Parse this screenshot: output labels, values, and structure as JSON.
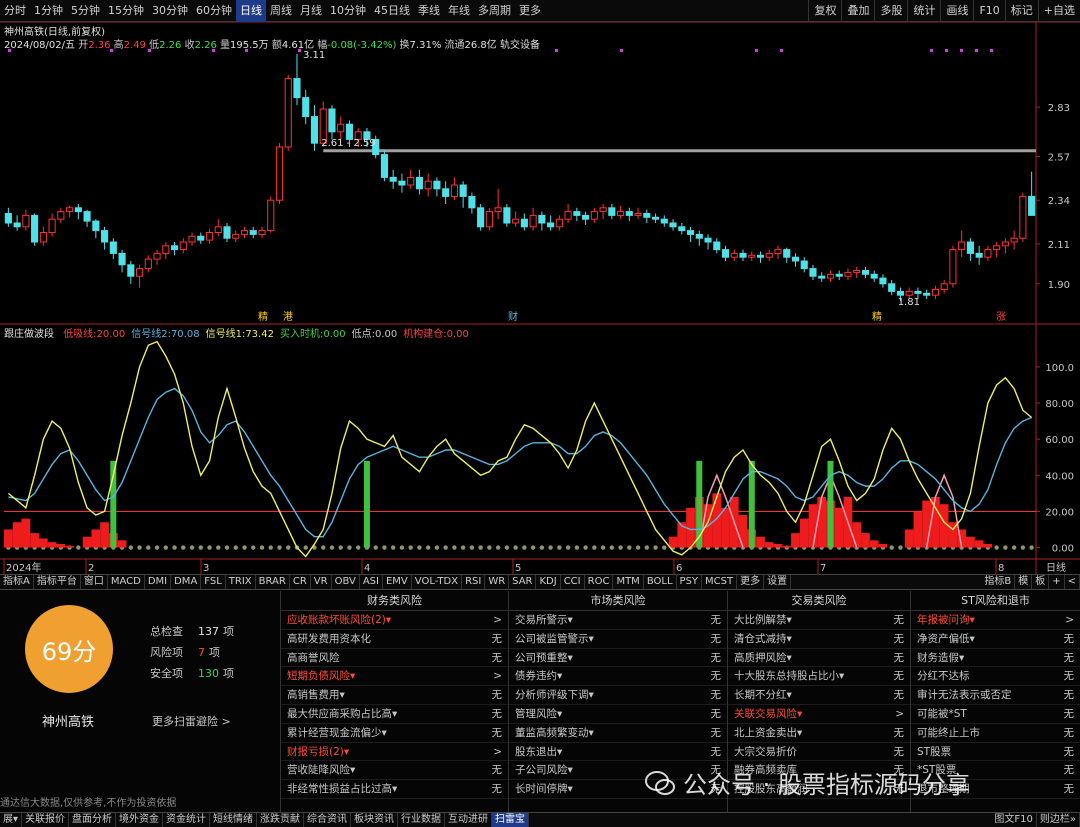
{
  "topbar": {
    "timeframes": [
      "分时",
      "1分钟",
      "5分钟",
      "15分钟",
      "30分钟",
      "60分钟",
      "日线",
      "周线",
      "月线",
      "10分钟",
      "45日线",
      "季线",
      "年线",
      "多周期",
      "更多"
    ],
    "active_timeframe": "日线",
    "tools": [
      "复权",
      "叠加",
      "多股",
      "统计",
      "画线",
      "F10",
      "标记",
      "+自选"
    ]
  },
  "header": {
    "title": "神州高铁(日线,前复权)",
    "date": "2024/08/02/五",
    "open_label": "开",
    "open": "2.36",
    "high_label": "高",
    "high": "2.49",
    "low_label": "低",
    "low": "2.26",
    "close_label": "收",
    "close": "2.26",
    "volume_label": "量",
    "volume": "195.5万",
    "amount_label": "额",
    "amount": "4.61亿",
    "change_label": "幅",
    "change": "-0.08(-3.42%)",
    "turnover_label": "换",
    "turnover": "7.31%",
    "float_label": "流通",
    "float_val": "26.8亿",
    "concept": "轨交设备"
  },
  "indicator_header": {
    "name": "跟庄做波段",
    "items": [
      {
        "label": "低吸线:",
        "value": "20.00",
        "color": "#ff4040"
      },
      {
        "label": "信号线2:",
        "value": "70.08",
        "color": "#5ab4e0"
      },
      {
        "label": "信号线1:",
        "value": "73.42",
        "color": "#f0f060"
      },
      {
        "label": "买入时机:",
        "value": "0.00",
        "color": "#40d040"
      },
      {
        "label": "低点:",
        "value": "0.00",
        "color": "#c8c8c8"
      },
      {
        "label": "机构建仓:",
        "value": "0.00",
        "color": "#ff4040"
      }
    ]
  },
  "annotations": {
    "peak_price": "3.11",
    "range_label": "2.61 - 2.59",
    "low_price": "1.81",
    "markers": [
      {
        "text": "精",
        "color": "#ffd000"
      },
      {
        "text": "港",
        "color": "#ffd000"
      },
      {
        "text": "财",
        "color": "#5ab4e0"
      },
      {
        "text": "精",
        "color": "#ffd000"
      },
      {
        "text": "涨",
        "color": "#ff4040"
      }
    ]
  },
  "price_axis": [
    "2.83",
    "2.57",
    "2.34",
    "2.11",
    "1.90"
  ],
  "indicator_axis": [
    "100.0",
    "80.00",
    "60.00",
    "40.00",
    "20.00",
    "0.00"
  ],
  "date_axis": {
    "labels": [
      "2024年",
      "2",
      "3",
      "4",
      "5",
      "6",
      "7",
      "8"
    ],
    "period": "日线"
  },
  "tabs": {
    "items": [
      "指标A",
      "指标平台",
      "窗口",
      "MACD",
      "DMI",
      "DMA",
      "FSL",
      "TRIX",
      "BRAR",
      "CR",
      "VR",
      "OBV",
      "ASI",
      "EMV",
      "VOL-TDX",
      "RSI",
      "WR",
      "SAR",
      "KDJ",
      "CCI",
      "ROC",
      "MTM",
      "BOLL",
      "PSY",
      "MCST",
      "更多",
      "设置"
    ],
    "right": [
      "指标B",
      "模",
      "板",
      "+",
      "<"
    ]
  },
  "risk": {
    "score": "69分",
    "company": "神州高铁",
    "stats": [
      {
        "label": "总检查",
        "value": "137",
        "unit": "项",
        "color": "#e0e0e0"
      },
      {
        "label": "风险项",
        "value": "7",
        "unit": "项",
        "color": "#ff4a3a"
      },
      {
        "label": "安全项",
        "value": "130",
        "unit": "项",
        "color": "#40d060"
      }
    ],
    "more": "更多扫雷避险 >",
    "disclaimer": "通达信大数据,仅供参考,不作为投资依据",
    "columns": [
      {
        "title": "财务类风险",
        "rows": [
          {
            "name": "应收账款坏账风险(2)▾",
            "val": ">",
            "alert": true
          },
          {
            "name": "高研发费用资本化",
            "val": "无"
          },
          {
            "name": "高商誉风险",
            "val": "无"
          },
          {
            "name": "短期负债风险▾",
            "val": ">",
            "alert": true
          },
          {
            "name": "高销售费用▾",
            "val": "无"
          },
          {
            "name": "最大供应商采购占比高▾",
            "val": "无"
          },
          {
            "name": "累计经营现金流偏少▾",
            "val": "无"
          },
          {
            "name": "财报亏损(2)▾",
            "val": ">",
            "alert": true
          },
          {
            "name": "营收陡降风险▾",
            "val": "无"
          },
          {
            "name": "非经常性损益占比过高▾",
            "val": "无"
          }
        ]
      },
      {
        "title": "市场类风险",
        "rows": [
          {
            "name": "交易所警示▾",
            "val": "无"
          },
          {
            "name": "公司被监管警示▾",
            "val": "无"
          },
          {
            "name": "公司预重整▾",
            "val": "无"
          },
          {
            "name": "债券违约▾",
            "val": "无"
          },
          {
            "name": "分析师评级下调▾",
            "val": "无"
          },
          {
            "name": "管理风险▾",
            "val": "无"
          },
          {
            "name": "董监高频繁变动▾",
            "val": "无"
          },
          {
            "name": "股东退出▾",
            "val": "无"
          },
          {
            "name": "子公司风险▾",
            "val": "无"
          },
          {
            "name": "长时间停牌▾",
            "val": "无"
          }
        ]
      },
      {
        "title": "交易类风险",
        "rows": [
          {
            "name": "大比例解禁▾",
            "val": "无"
          },
          {
            "name": "清仓式减持▾",
            "val": "无"
          },
          {
            "name": "高质押风险▾",
            "val": "无"
          },
          {
            "name": "十大股东总持股占比小▾",
            "val": "无"
          },
          {
            "name": "长期不分红▾",
            "val": "无"
          },
          {
            "name": "关联交易风险▾",
            "val": ">",
            "alert": true
          },
          {
            "name": "北上资金卖出▾",
            "val": "无"
          },
          {
            "name": "大宗交易折价",
            "val": "无"
          },
          {
            "name": "融券高频卖库",
            "val": "无"
          },
          {
            "name": "控股股东高额润",
            "val": "无"
          }
        ]
      },
      {
        "title": "ST风险和退市",
        "rows": [
          {
            "name": "年报被问询▾",
            "val": ">",
            "alert": true
          },
          {
            "name": "净资产偏低▾",
            "val": "无"
          },
          {
            "name": "财务造假▾",
            "val": "无"
          },
          {
            "name": "分红不达标",
            "val": "无"
          },
          {
            "name": "审计无法表示或否定",
            "val": "无"
          },
          {
            "name": "可能被*ST",
            "val": "无"
          },
          {
            "name": "可能终止上市",
            "val": "无"
          },
          {
            "name": "ST股票",
            "val": "无"
          },
          {
            "name": "*ST股票",
            "val": "无"
          },
          {
            "name": "退市整理期",
            "val": "无"
          }
        ]
      }
    ]
  },
  "statusbar": {
    "items": [
      "展▾",
      "关联报价",
      "盘面分析",
      "境外资金",
      "资金统计",
      "短线情绪",
      "涨跌贡献",
      "综合资讯",
      "板块资讯",
      "行业数据",
      "互动进研",
      "扫雷宝"
    ],
    "active": "扫雷宝",
    "right": [
      "图文F10",
      "则边栏»"
    ]
  },
  "watermark": "公众号 · 股票指标源码分享",
  "colors": {
    "up": "#ff3030",
    "down": "#50e0e8",
    "signal1": "#f0f060",
    "signal2": "#5ab4e0",
    "buy": "#40c040",
    "risk_line": "#ff4040",
    "orange": "#f0a030"
  },
  "chart_data": {
    "type": "candlestick",
    "price_range": [
      1.72,
      3.12
    ],
    "indicator_range": [
      -8,
      116
    ],
    "candles": [
      [
        2.27,
        2.22,
        2.3,
        2.2
      ],
      [
        2.22,
        2.2,
        2.26,
        2.18
      ],
      [
        2.2,
        2.26,
        2.29,
        2.18
      ],
      [
        2.26,
        2.12,
        2.27,
        2.1
      ],
      [
        2.12,
        2.17,
        2.2,
        2.1
      ],
      [
        2.17,
        2.24,
        2.27,
        2.15
      ],
      [
        2.24,
        2.28,
        2.3,
        2.22
      ],
      [
        2.28,
        2.3,
        2.31,
        2.25
      ],
      [
        2.3,
        2.28,
        2.32,
        2.24
      ],
      [
        2.28,
        2.23,
        2.29,
        2.2
      ],
      [
        2.23,
        2.18,
        2.24,
        2.14
      ],
      [
        2.18,
        2.12,
        2.2,
        2.08
      ],
      [
        2.12,
        2.06,
        2.14,
        2.03
      ],
      [
        2.06,
        2.0,
        2.08,
        1.96
      ],
      [
        2.0,
        1.94,
        2.02,
        1.9
      ],
      [
        1.94,
        1.98,
        2.0,
        1.88
      ],
      [
        1.98,
        2.03,
        2.05,
        1.96
      ],
      [
        2.03,
        2.06,
        2.08,
        2.0
      ],
      [
        2.06,
        2.1,
        2.12,
        2.03
      ],
      [
        2.1,
        2.08,
        2.12,
        2.05
      ],
      [
        2.08,
        2.12,
        2.14,
        2.06
      ],
      [
        2.12,
        2.15,
        2.17,
        2.1
      ],
      [
        2.15,
        2.13,
        2.17,
        2.11
      ],
      [
        2.13,
        2.17,
        2.19,
        2.11
      ],
      [
        2.17,
        2.2,
        2.24,
        2.15
      ],
      [
        2.2,
        2.14,
        2.22,
        2.12
      ],
      [
        2.14,
        2.16,
        2.18,
        2.12
      ],
      [
        2.16,
        2.18,
        2.2,
        2.14
      ],
      [
        2.18,
        2.16,
        2.2,
        2.14
      ],
      [
        2.16,
        2.18,
        2.2,
        2.14
      ],
      [
        2.18,
        2.34,
        2.36,
        2.17
      ],
      [
        2.34,
        2.62,
        2.64,
        2.32
      ],
      [
        2.62,
        2.98,
        3.0,
        2.6
      ],
      [
        2.98,
        2.88,
        3.11,
        2.84
      ],
      [
        2.88,
        2.78,
        2.92,
        2.74
      ],
      [
        2.78,
        2.64,
        2.84,
        2.6
      ],
      [
        2.64,
        2.82,
        2.86,
        2.62
      ],
      [
        2.82,
        2.7,
        2.84,
        2.66
      ],
      [
        2.7,
        2.74,
        2.78,
        2.66
      ],
      [
        2.74,
        2.66,
        2.76,
        2.62
      ],
      [
        2.66,
        2.7,
        2.72,
        2.62
      ],
      [
        2.7,
        2.66,
        2.72,
        2.62
      ],
      [
        2.66,
        2.58,
        2.68,
        2.56
      ],
      [
        2.58,
        2.46,
        2.6,
        2.44
      ],
      [
        2.46,
        2.44,
        2.5,
        2.4
      ],
      [
        2.44,
        2.42,
        2.48,
        2.38
      ],
      [
        2.42,
        2.46,
        2.5,
        2.4
      ],
      [
        2.46,
        2.4,
        2.5,
        2.37
      ],
      [
        2.4,
        2.44,
        2.48,
        2.36
      ],
      [
        2.44,
        2.4,
        2.46,
        2.36
      ],
      [
        2.4,
        2.36,
        2.44,
        2.32
      ],
      [
        2.36,
        2.42,
        2.46,
        2.34
      ],
      [
        2.42,
        2.36,
        2.44,
        2.3
      ],
      [
        2.36,
        2.3,
        2.38,
        2.27
      ],
      [
        2.3,
        2.2,
        2.32,
        2.18
      ],
      [
        2.2,
        2.28,
        2.3,
        2.18
      ],
      [
        2.28,
        2.3,
        2.4,
        2.24
      ],
      [
        2.3,
        2.22,
        2.32,
        2.2
      ],
      [
        2.22,
        2.24,
        2.28,
        2.2
      ],
      [
        2.24,
        2.2,
        2.27,
        2.18
      ],
      [
        2.2,
        2.26,
        2.3,
        2.18
      ],
      [
        2.26,
        2.22,
        2.28,
        2.18
      ],
      [
        2.22,
        2.2,
        2.26,
        2.18
      ],
      [
        2.2,
        2.24,
        2.26,
        2.18
      ],
      [
        2.24,
        2.28,
        2.32,
        2.22
      ],
      [
        2.28,
        2.26,
        2.3,
        2.23
      ],
      [
        2.26,
        2.24,
        2.28,
        2.21
      ],
      [
        2.24,
        2.28,
        2.3,
        2.22
      ],
      [
        2.28,
        2.3,
        2.32,
        2.24
      ],
      [
        2.3,
        2.26,
        2.32,
        2.24
      ],
      [
        2.26,
        2.28,
        2.31,
        2.24
      ],
      [
        2.28,
        2.26,
        2.3,
        2.23
      ],
      [
        2.26,
        2.27,
        2.3,
        2.24
      ],
      [
        2.27,
        2.25,
        2.29,
        2.22
      ],
      [
        2.25,
        2.24,
        2.27,
        2.22
      ],
      [
        2.24,
        2.22,
        2.26,
        2.2
      ],
      [
        2.22,
        2.2,
        2.24,
        2.18
      ],
      [
        2.2,
        2.18,
        2.22,
        2.16
      ],
      [
        2.18,
        2.16,
        2.2,
        2.12
      ],
      [
        2.16,
        2.14,
        2.18,
        2.1
      ],
      [
        2.14,
        2.12,
        2.16,
        2.08
      ],
      [
        2.12,
        2.08,
        2.14,
        2.06
      ],
      [
        2.08,
        2.04,
        2.1,
        2.02
      ],
      [
        2.04,
        2.06,
        2.08,
        2.02
      ],
      [
        2.06,
        2.04,
        2.08,
        2.02
      ],
      [
        2.04,
        2.05,
        2.07,
        2.02
      ],
      [
        2.05,
        2.04,
        2.07,
        2.01
      ],
      [
        2.04,
        2.06,
        2.08,
        2.02
      ],
      [
        2.06,
        2.08,
        2.1,
        2.03
      ],
      [
        2.08,
        2.04,
        2.09,
        2.01
      ],
      [
        2.04,
        2.02,
        2.06,
        1.99
      ],
      [
        2.02,
        1.98,
        2.04,
        1.96
      ],
      [
        1.98,
        1.94,
        2.0,
        1.92
      ],
      [
        1.94,
        1.93,
        1.96,
        1.91
      ],
      [
        1.93,
        1.95,
        1.97,
        1.91
      ],
      [
        1.95,
        1.94,
        1.97,
        1.92
      ],
      [
        1.94,
        1.96,
        1.98,
        1.92
      ],
      [
        1.96,
        1.97,
        1.99,
        1.93
      ],
      [
        1.97,
        1.95,
        1.99,
        1.93
      ],
      [
        1.95,
        1.93,
        1.97,
        1.91
      ],
      [
        1.93,
        1.9,
        1.95,
        1.88
      ],
      [
        1.9,
        1.86,
        1.92,
        1.84
      ],
      [
        1.86,
        1.84,
        1.88,
        1.81
      ],
      [
        1.84,
        1.86,
        1.88,
        1.82
      ],
      [
        1.86,
        1.85,
        1.88,
        1.82
      ],
      [
        1.85,
        1.84,
        1.87,
        1.82
      ],
      [
        1.84,
        1.87,
        1.89,
        1.82
      ],
      [
        1.87,
        1.9,
        1.92,
        1.85
      ],
      [
        1.9,
        2.08,
        2.1,
        1.88
      ],
      [
        2.08,
        2.12,
        2.18,
        2.04
      ],
      [
        2.12,
        2.06,
        2.14,
        2.02
      ],
      [
        2.06,
        2.04,
        2.1,
        2.0
      ],
      [
        2.04,
        2.08,
        2.1,
        2.02
      ],
      [
        2.08,
        2.1,
        2.12,
        2.04
      ],
      [
        2.1,
        2.12,
        2.14,
        2.06
      ],
      [
        2.12,
        2.14,
        2.18,
        2.08
      ],
      [
        2.14,
        2.36,
        2.38,
        2.12
      ],
      [
        2.36,
        2.26,
        2.49,
        2.26
      ]
    ],
    "signal1": [
      30,
      26,
      22,
      40,
      60,
      70,
      66,
      55,
      36,
      22,
      18,
      20,
      40,
      62,
      80,
      100,
      112,
      114,
      106,
      96,
      80,
      56,
      40,
      48,
      72,
      88,
      72,
      55,
      42,
      34,
      30,
      20,
      10,
      0,
      -5,
      2,
      10,
      30,
      55,
      70,
      66,
      60,
      58,
      56,
      62,
      50,
      46,
      42,
      50,
      56,
      60,
      52,
      48,
      44,
      40,
      42,
      48,
      50,
      60,
      68,
      66,
      62,
      58,
      52,
      44,
      54,
      70,
      80,
      70,
      60,
      50,
      40,
      30,
      20,
      10,
      4,
      -2,
      -4,
      0,
      6,
      14,
      28,
      42,
      50,
      54,
      46,
      40,
      36,
      30,
      20,
      14,
      24,
      40,
      56,
      60,
      48,
      34,
      26,
      30,
      38,
      54,
      66,
      60,
      48,
      38,
      30,
      22,
      14,
      10,
      16,
      30,
      56,
      80,
      90,
      94,
      88,
      76,
      72,
      70,
      74,
      86,
      73
    ],
    "signal2": [
      28,
      27,
      26,
      30,
      38,
      46,
      52,
      54,
      48,
      40,
      32,
      26,
      28,
      36,
      48,
      60,
      72,
      82,
      86,
      88,
      84,
      76,
      64,
      58,
      62,
      68,
      70,
      64,
      56,
      48,
      40,
      34,
      26,
      18,
      10,
      6,
      6,
      14,
      26,
      38,
      46,
      50,
      52,
      54,
      56,
      54,
      52,
      50,
      50,
      52,
      54,
      54,
      52,
      50,
      48,
      46,
      46,
      48,
      52,
      56,
      58,
      58,
      58,
      56,
      52,
      52,
      56,
      62,
      64,
      62,
      58,
      52,
      46,
      40,
      32,
      24,
      18,
      12,
      10,
      10,
      12,
      16,
      22,
      30,
      38,
      42,
      42,
      40,
      38,
      34,
      28,
      26,
      28,
      34,
      40,
      42,
      40,
      36,
      34,
      34,
      38,
      44,
      48,
      48,
      46,
      42,
      38,
      32,
      26,
      22,
      20,
      24,
      32,
      46,
      58,
      66,
      70,
      72,
      72,
      72,
      72,
      74,
      70
    ]
  }
}
